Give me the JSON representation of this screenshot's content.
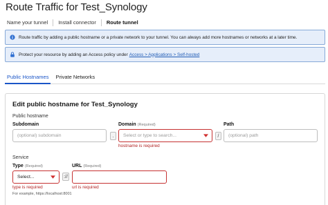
{
  "page": {
    "title": "Route Traffic for Test_Synology"
  },
  "steps": [
    "Name your tunnel",
    "Install connector",
    "Route tunnel"
  ],
  "banners": [
    {
      "text": "Route traffic by adding a public hostname or a private network to your tunnel. You can always add more hostnames or networks at a later time.",
      "icon": "info-icon"
    },
    {
      "text": "Protect your resource by adding an Access policy under",
      "link": "Access > Applications > Self-hosted",
      "icon": "lock-icon"
    }
  ],
  "tabs": [
    "Public Hostnames",
    "Private Networks"
  ],
  "card": {
    "title": "Edit public hostname for Test_Synology",
    "public_hostname_label": "Public hostname",
    "subdomain": {
      "label": "Subdomain",
      "placeholder": "(optional) subdomain"
    },
    "domain": {
      "label": "Domain",
      "required": "(Required)",
      "placeholder": "Select or type to search...",
      "error": "hostname is required"
    },
    "path": {
      "label": "Path",
      "placeholder": "(optional) path"
    },
    "dot": ".",
    "slash": "/",
    "service_label": "Service",
    "type": {
      "label": "Type",
      "required": "(Required)",
      "value": "Select...",
      "error": "type is required",
      "hint": "For example, https://localhost:8001"
    },
    "scheme_sep": "://",
    "url": {
      "label": "URL",
      "required": "(Required)",
      "value": "",
      "error": "url is required"
    }
  },
  "colors": {
    "accent": "#1a55c7",
    "error": "#c53030",
    "banner_bg": "#e6eefa",
    "banner_border": "#86a9d8"
  }
}
